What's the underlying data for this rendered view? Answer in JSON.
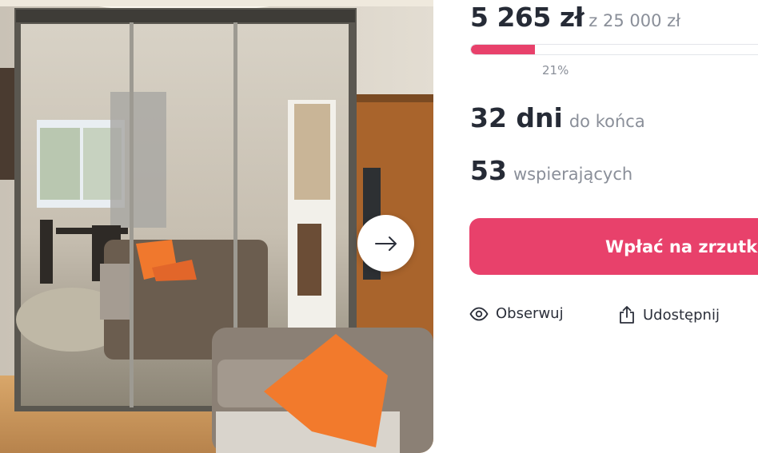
{
  "campaign": {
    "raised": "5 265 zł",
    "goal": "z 25 000 zł",
    "progress_fraction": 0.21,
    "percent_text": "21%",
    "days_number": "32 dni",
    "days_label": "do końca",
    "backers_number": "53",
    "backers_label": "wspierających"
  },
  "actions": {
    "donate_label": "Wpłać na zrzutkę",
    "follow_label": "Obserwuj",
    "share_label": "Udostępnij"
  },
  "gallery": {
    "next_icon": "arrow-right-icon"
  },
  "colors": {
    "accent": "#e8416b",
    "text_dark": "#262b36",
    "text_muted": "#8a8f99"
  }
}
